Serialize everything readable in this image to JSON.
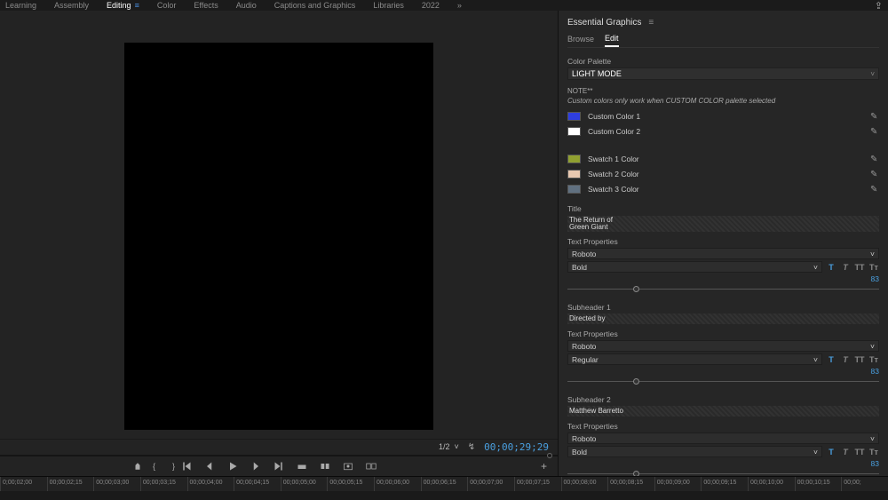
{
  "top_tabs": {
    "learning": "Learning",
    "assembly": "Assembly",
    "editing": "Editing",
    "color": "Color",
    "effects": "Effects",
    "audio": "Audio",
    "captions": "Captions and Graphics",
    "libraries": "Libraries",
    "year": "2022"
  },
  "viewer": {
    "zoom": "1/2",
    "timecode": "00;00;29;29"
  },
  "panel": {
    "title": "Essential Graphics",
    "tabs": {
      "browse": "Browse",
      "edit": "Edit"
    },
    "color_palette_label": "Color Palette",
    "color_palette_value": "LIGHT MODE",
    "note_label": "NOTE**",
    "note_text": "Custom colors only work when CUSTOM COLOR palette selected",
    "custom_colors": [
      {
        "label": "Custom Color 1",
        "hex": "#2e3ee0"
      },
      {
        "label": "Custom Color 2",
        "hex": "#ffffff"
      }
    ],
    "swatch_colors": [
      {
        "label": "Swatch 1 Color",
        "hex": "#90a030"
      },
      {
        "label": "Swatch 2 Color",
        "hex": "#e8c8b0"
      },
      {
        "label": "Swatch 3 Color",
        "hex": "#607080"
      }
    ],
    "title_section": {
      "label": "Title",
      "value_line1": "The Return of",
      "value_line2": "Green Giant",
      "text_properties_label": "Text Properties",
      "font": "Roboto",
      "weight": "Bold",
      "size": "83"
    },
    "sub1": {
      "label": "Subheader 1",
      "value": "Directed by",
      "text_properties_label": "Text Properties",
      "font": "Roboto",
      "weight": "Regular",
      "size": "83"
    },
    "sub2": {
      "label": "Subheader 2",
      "value": "Matthew Barretto",
      "text_properties_label": "Text Properties",
      "font": "Roboto",
      "weight": "Bold",
      "size": "83"
    }
  },
  "timeline": {
    "ticks": [
      "0;00;02;00",
      "00;00;02;15",
      "00;00;03;00",
      "00;00;03;15",
      "00;00;04;00",
      "00;00;04;15",
      "00;00;05;00",
      "00;00;05;15",
      "00;00;06;00",
      "00;00;06;15",
      "00;00;07;00",
      "00;00;07;15",
      "00;00;08;00",
      "00;00;08;15",
      "00;00;09;00",
      "00;00;09;15",
      "00;00;10;00",
      "00;00;10;15",
      "00;00;"
    ]
  }
}
